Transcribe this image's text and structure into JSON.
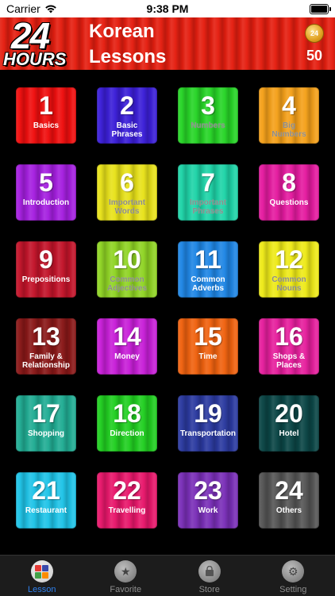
{
  "status_bar": {
    "carrier": "Carrier",
    "time": "9:38 PM"
  },
  "header": {
    "logo_number": "24",
    "logo_word": "HOURS",
    "title_line1": "Korean",
    "title_line2": "Lessons",
    "coin_label": "24",
    "coin_count": "50"
  },
  "lessons": [
    {
      "num": "1",
      "label": "Basics",
      "color": "#f00e0e"
    },
    {
      "num": "2",
      "label": "Basic\nPhrases",
      "color": "#3b1fd8"
    },
    {
      "num": "3",
      "label": "Numbers",
      "color": "#27d527"
    },
    {
      "num": "4",
      "label": "Big\nNumbers",
      "color": "#f5a11a"
    },
    {
      "num": "5",
      "label": "Introduction",
      "color": "#a51fe0"
    },
    {
      "num": "6",
      "label": "Important\nWords",
      "color": "#e8e21a"
    },
    {
      "num": "7",
      "label": "Important\nPhrases",
      "color": "#1fd4a8"
    },
    {
      "num": "8",
      "label": "Questions",
      "color": "#e51ba0"
    },
    {
      "num": "9",
      "label": "Prepositions",
      "color": "#c3142a"
    },
    {
      "num": "10",
      "label": "Common\nAdjectives",
      "color": "#8fd424"
    },
    {
      "num": "11",
      "label": "Common\nAdverbs",
      "color": "#1f86e5"
    },
    {
      "num": "12",
      "label": "Common\nNouns",
      "color": "#eeea18"
    },
    {
      "num": "13",
      "label": "Family &\nRelationship",
      "color": "#8a1818"
    },
    {
      "num": "14",
      "label": "Money",
      "color": "#c81fd8"
    },
    {
      "num": "15",
      "label": "Time",
      "color": "#f0620f"
    },
    {
      "num": "16",
      "label": "Shops &\nPlaces",
      "color": "#e61f9d"
    },
    {
      "num": "17",
      "label": "Shopping",
      "color": "#21ad94"
    },
    {
      "num": "18",
      "label": "Direction",
      "color": "#21cf21"
    },
    {
      "num": "19",
      "label": "Transportation",
      "color": "#2b3aa0"
    },
    {
      "num": "20",
      "label": "Hotel",
      "color": "#0b4646"
    },
    {
      "num": "21",
      "label": "Restaurant",
      "color": "#1fc4e8"
    },
    {
      "num": "22",
      "label": "Travelling",
      "color": "#e8176b"
    },
    {
      "num": "23",
      "label": "Work",
      "color": "#7a2fb8"
    },
    {
      "num": "24",
      "label": "Others",
      "color": "#555555"
    }
  ],
  "tabs": [
    {
      "label": "Lesson",
      "icon": "lesson-grid-icon",
      "active": true
    },
    {
      "label": "Favorite",
      "icon": "star-icon",
      "active": false
    },
    {
      "label": "Store",
      "icon": "store-icon",
      "active": false
    },
    {
      "label": "Setting",
      "icon": "gear-icon",
      "active": false
    }
  ]
}
